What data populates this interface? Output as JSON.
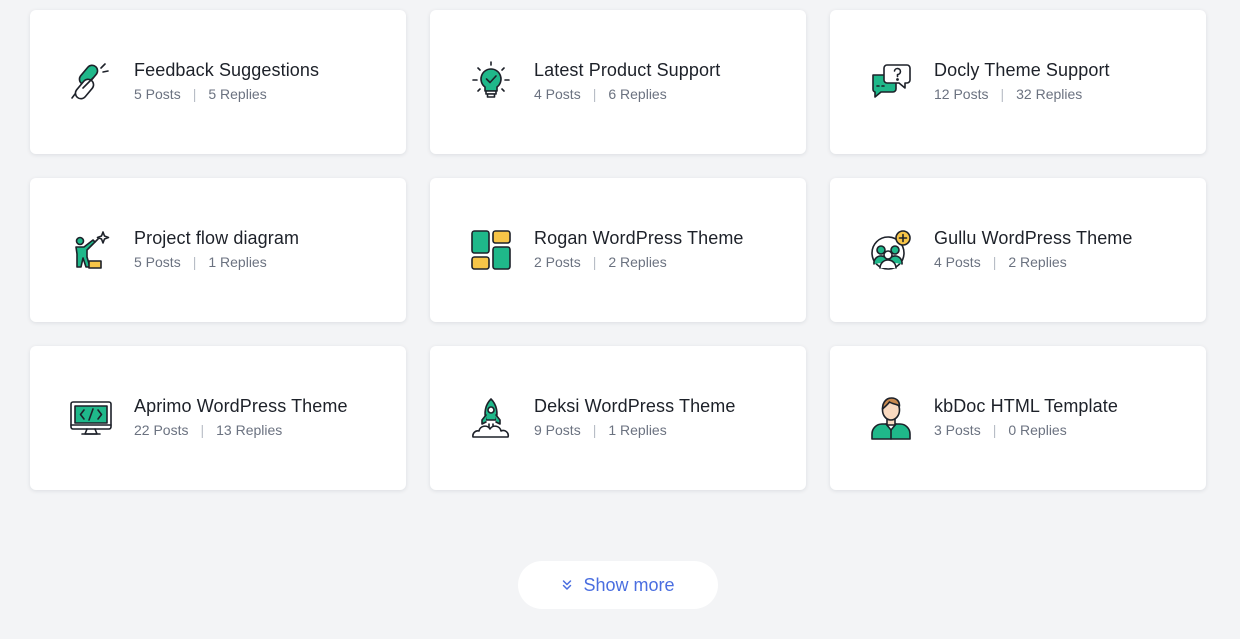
{
  "forums": [
    {
      "icon": "link-chain-icon",
      "title": "Feedback Suggestions",
      "posts": "5 Posts",
      "replies": "5 Replies"
    },
    {
      "icon": "lightbulb-check-icon",
      "title": "Latest Product Support",
      "posts": "4 Posts",
      "replies": "6 Replies"
    },
    {
      "icon": "chat-question-icon",
      "title": "Docly Theme Support",
      "posts": "12 Posts",
      "replies": "32 Replies"
    },
    {
      "icon": "person-climb-star-icon",
      "title": "Project flow diagram",
      "posts": "5 Posts",
      "replies": "1 Replies"
    },
    {
      "icon": "dashboard-blocks-icon",
      "title": "Rogan WordPress Theme",
      "posts": "2 Posts",
      "replies": "2 Replies"
    },
    {
      "icon": "team-add-icon",
      "title": "Gullu WordPress Theme",
      "posts": "4 Posts",
      "replies": "2 Replies"
    },
    {
      "icon": "monitor-code-icon",
      "title": "Aprimo WordPress Theme",
      "posts": "22 Posts",
      "replies": "13 Replies"
    },
    {
      "icon": "rocket-launch-icon",
      "title": "Deksi WordPress Theme",
      "posts": "9 Posts",
      "replies": "1 Replies"
    },
    {
      "icon": "user-avatar-icon",
      "title": "kbDoc HTML Template",
      "posts": "3 Posts",
      "replies": "0 Replies"
    }
  ],
  "show_more": {
    "label": "Show more",
    "icon": "double-chevron-down-icon"
  },
  "colors": {
    "accent": "#4a6ee0",
    "green": "#1fb88a",
    "yellow": "#f7c548",
    "outline": "#1d2129"
  }
}
